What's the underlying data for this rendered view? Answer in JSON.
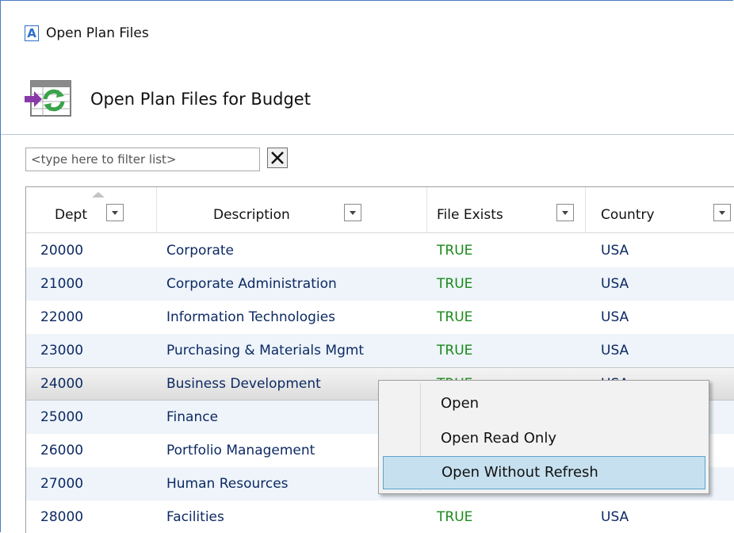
{
  "window": {
    "title": "Open Plan Files",
    "logo_letter": "A"
  },
  "header": {
    "title": "Open Plan Files for Budget"
  },
  "filter": {
    "placeholder": "<type here to filter list>"
  },
  "columns": [
    "Dept",
    "Description",
    "File Exists",
    "Country"
  ],
  "rows": [
    {
      "dept": "20000",
      "description": "Corporate",
      "file_exists": "TRUE",
      "country": "USA"
    },
    {
      "dept": "21000",
      "description": "Corporate Administration",
      "file_exists": "TRUE",
      "country": "USA"
    },
    {
      "dept": "22000",
      "description": "Information Technologies",
      "file_exists": "TRUE",
      "country": "USA"
    },
    {
      "dept": "23000",
      "description": "Purchasing & Materials Mgmt",
      "file_exists": "TRUE",
      "country": "USA"
    },
    {
      "dept": "24000",
      "description": "Business Development",
      "file_exists": "TRUE",
      "country": "USA"
    },
    {
      "dept": "25000",
      "description": "Finance",
      "file_exists": "",
      "country": ""
    },
    {
      "dept": "26000",
      "description": "Portfolio Management",
      "file_exists": "",
      "country": ""
    },
    {
      "dept": "27000",
      "description": "Human Resources",
      "file_exists": "",
      "country": ""
    },
    {
      "dept": "28000",
      "description": "Facilities",
      "file_exists": "TRUE",
      "country": "USA"
    }
  ],
  "context_menu": {
    "items": [
      "Open",
      "Open Read Only",
      "Open Without Refresh"
    ],
    "highlighted": "Open Without Refresh"
  },
  "colors": {
    "accent": "#4a7fc1",
    "true_text": "#1a8a1a",
    "row_alt": "#eef4fa",
    "menu_highlight": "#c6e0ef"
  }
}
